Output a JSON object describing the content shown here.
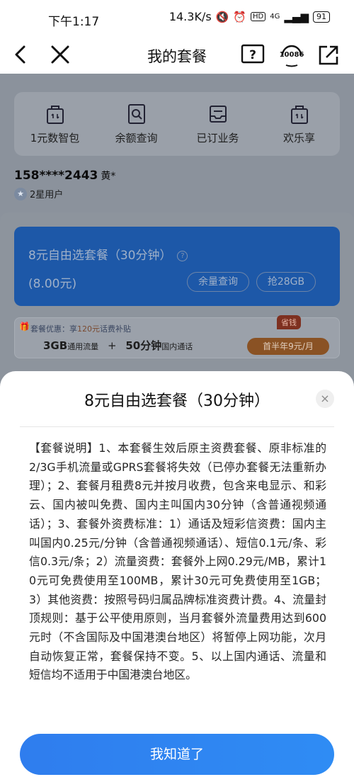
{
  "status_bar": {
    "time": "下午1:17",
    "speed": "14.3K/s",
    "network": "4G",
    "battery": "91"
  },
  "nav": {
    "title": "我的套餐",
    "service_number": "10086"
  },
  "quick_actions": [
    {
      "label": "1元数智包",
      "icon": "bag-icon"
    },
    {
      "label": "余额查询",
      "icon": "search-doc-icon"
    },
    {
      "label": "已订业务",
      "icon": "inbox-icon"
    },
    {
      "label": "欢乐享",
      "icon": "bag-icon"
    }
  ],
  "user": {
    "phone": "158****2443",
    "name": "黄*",
    "level": "2星用户"
  },
  "plan": {
    "name": "8元自由选套餐（30分钟）",
    "price": "(8.00元)",
    "btn_balance": "余量查询",
    "btn_grab": "抢28GB"
  },
  "promo": {
    "label": "套餐优惠：享",
    "amount": "120元",
    "label_tail": "话费补贴",
    "flow": "3GB",
    "flow_unit": "通用流量",
    "plus": "+",
    "minutes": "50分钟",
    "minutes_unit": "国内通话",
    "badge": "省钱",
    "button": "首半年9元/月"
  },
  "sheet": {
    "title": "8元自由选套餐（30分钟）",
    "close": "×",
    "body": "【套餐说明】1、本套餐生效后原主资费套餐、原非标准的2/3G手机流量或GPRS套餐将失效（已停办套餐无法重新办理）；2、套餐月租费8元并按月收费，包含来电显示、和彩云、国内被叫免费、国内主叫国内30分钟（含普通视频通话）；3、套餐外资费标准：1）通话及短彩信资费：国内主叫国内0.25元/分钟（含普通视频通话）、短信0.1元/条、彩信0.3元/条；2）流量资费：套餐外上网0.29元/MB，累计10元可免费使用至100MB，累计30元可免费使用至1GB；3）其他资费：按照号码归属品牌标准资费计费。4、流量封顶规则：基于公平使用原则，当月套餐外流量费用达到600元时（不含国际及中国港澳台地区）将暂停上网功能，次月自动恢复正常，套餐保持不变。5、以上国内通话、流量和短信均不适用于中国港澳台地区。",
    "confirm": "我知道了"
  },
  "colors": {
    "primary": "#2f7dee",
    "overlay": "#8b929c"
  }
}
